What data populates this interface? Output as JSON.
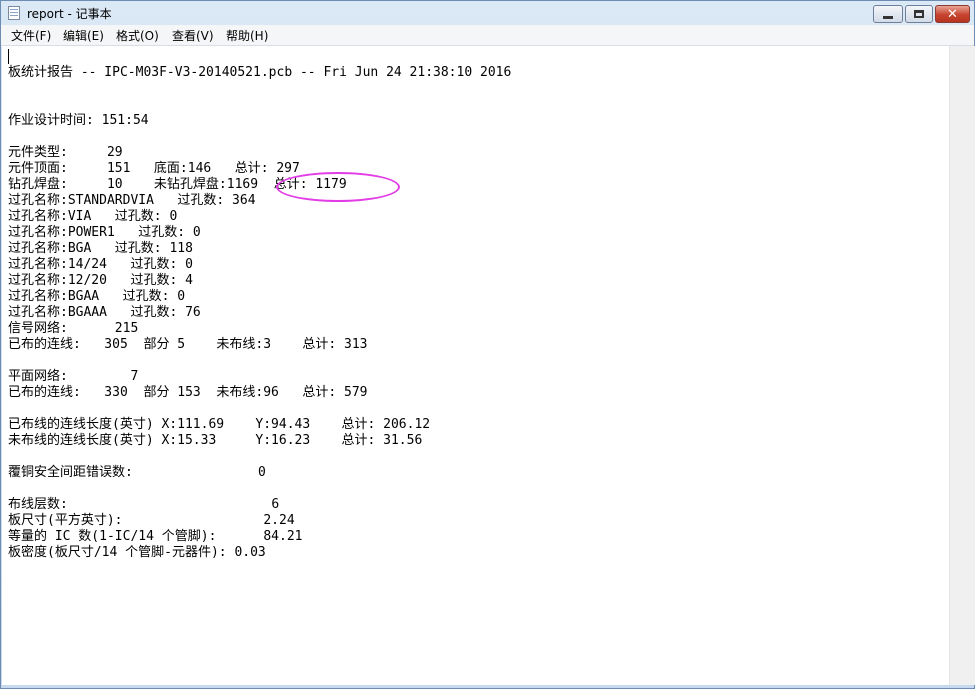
{
  "window": {
    "title": "report - 记事本",
    "controls": {
      "minimize": "minimize",
      "maximize": "maximize",
      "close": "✕"
    }
  },
  "menu": [
    "文件(F)",
    "编辑(E)",
    "格式(O)",
    "查看(V)",
    "帮助(H)"
  ],
  "content": {
    "lines": [
      "板统计报告 -- IPC-M03F-V3-20140521.pcb -- Fri Jun 24 21:38:10 2016",
      "作业设计时间: 151:54",
      "元件类型:     29",
      "元件顶面:     151   底面:146   总计: 297",
      "钻孔焊盘:     10    未钻孔焊盘:1169  总计: 1179",
      "过孔名称:STANDARDVIA   过孔数: 364",
      "过孔名称:VIA   过孔数: 0",
      "过孔名称:POWER1   过孔数: 0",
      "过孔名称:BGA   过孔数: 118",
      "过孔名称:14/24   过孔数: 0",
      "过孔名称:12/20   过孔数: 4",
      "过孔名称:BGAA   过孔数: 0",
      "过孔名称:BGAAA   过孔数: 76",
      "信号网络:      215",
      "已布的连线:   305  部分 5    未布线:3    总计: 313",
      "平面网络:        7",
      "已布的连线:   330  部分 153  未布线:96   总计: 579",
      "已布线的连线长度(英寸) X:111.69    Y:94.43    总计: 206.12",
      "未布线的连线长度(英寸) X:15.33     Y:16.23    总计: 31.56",
      "覆铜安全间距错误数:                0",
      "布线层数:                          6",
      "板尺寸(平方英寸):                  2.24",
      "等量的 IC 数(1-IC/14 个管脚):      84.21",
      "板密度(板尺寸/14 个管脚-元器件): 0.03"
    ]
  },
  "annotation": {
    "color": "#e33de6",
    "marks": "总计: 1179"
  }
}
